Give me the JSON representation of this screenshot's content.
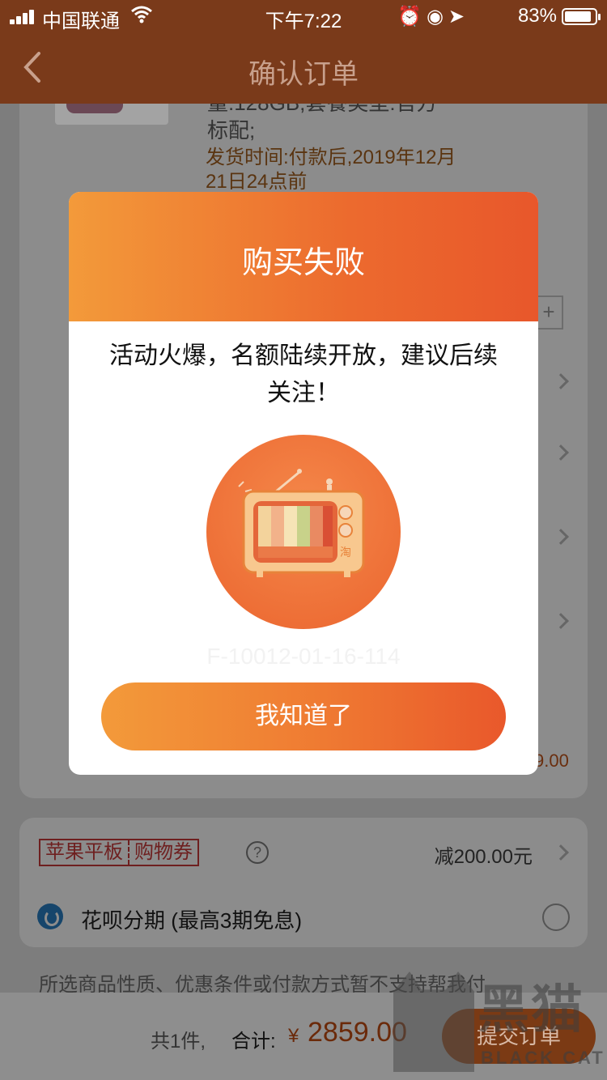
{
  "status_bar": {
    "carrier": "中国联通",
    "time": "下午7:22",
    "battery": "83%",
    "battery_level": 0.83
  },
  "nav": {
    "title": "确认订单"
  },
  "order": {
    "spec": "量:128GB;套餐类型:官方标配;",
    "ship_time": "发货时间:付款后,2019年12月21日24点前",
    "price_peek": "9.00"
  },
  "coupon": {
    "tag_left": "苹果平板",
    "tag_right": "购物券",
    "help": "?",
    "discount": "减200.00元"
  },
  "payment": {
    "huabei_label": "花呗分期 (最高3期免息)"
  },
  "notice": "所选商品性质、优惠条件或付款方式暂不支持帮我付",
  "footer": {
    "count": "共1件,",
    "total_label": "合计:",
    "currency": "¥",
    "total_amount": "2859.00",
    "submit": "提交订单"
  },
  "modal": {
    "title": "购买失败",
    "message": "活动火爆，名额陆续开放，建议后续关注！",
    "error_code": "F-10012-01-16-114",
    "ok_button": "我知道了",
    "tv_char": "淘"
  },
  "watermark": {
    "cn": "黑猫",
    "en": "BLACK CAT"
  },
  "colors": {
    "accent": "#ec6a2e",
    "accent_light": "#f39a3a",
    "nav_bg": "#7a3a1a"
  }
}
